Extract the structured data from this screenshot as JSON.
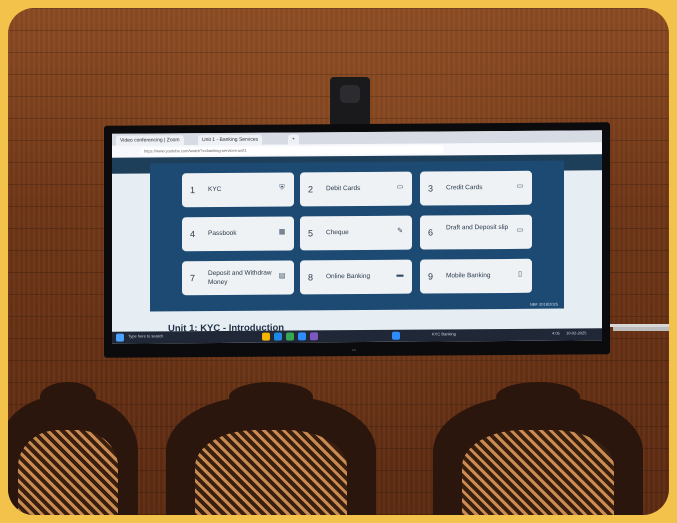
{
  "scene": {
    "description_tags": [
      "wood-paneled-wall",
      "wall-mounted-display",
      "webcam",
      "carved-chairs"
    ]
  },
  "browser": {
    "tabs": [
      "Video conferencing | Zoom",
      "Unit 1 - Banking Services",
      "+"
    ],
    "url": "https://www.youtube.com/watch?v=banking-services-unit1"
  },
  "slide": {
    "cards": [
      {
        "number": "1",
        "label": "KYC",
        "icon": "shield-icon"
      },
      {
        "number": "2",
        "label": "Debit Cards",
        "icon": "card-icon"
      },
      {
        "number": "3",
        "label": "Credit Cards",
        "icon": "card-icon"
      },
      {
        "number": "4",
        "label": "Passbook",
        "icon": "book-icon"
      },
      {
        "number": "5",
        "label": "Cheque",
        "icon": "pen-icon"
      },
      {
        "number": "6",
        "label": "Draft and Deposit slip",
        "icon": "card-icon"
      },
      {
        "number": "7",
        "label": "Deposit and Withdraw Money",
        "icon": "cash-icon"
      },
      {
        "number": "8",
        "label": "Online Banking",
        "icon": "laptop-icon"
      },
      {
        "number": "9",
        "label": "Mobile Banking",
        "icon": "phone-icon"
      }
    ],
    "footer_caption": "NBF 2018/2025"
  },
  "page_heading": "Unit 1: KYC - Introduction",
  "taskbar": {
    "search_text": "Type here to search",
    "weather": "KYC Banking",
    "time": "4:05",
    "date": "10-02-2025"
  },
  "tv_brand": "LG"
}
